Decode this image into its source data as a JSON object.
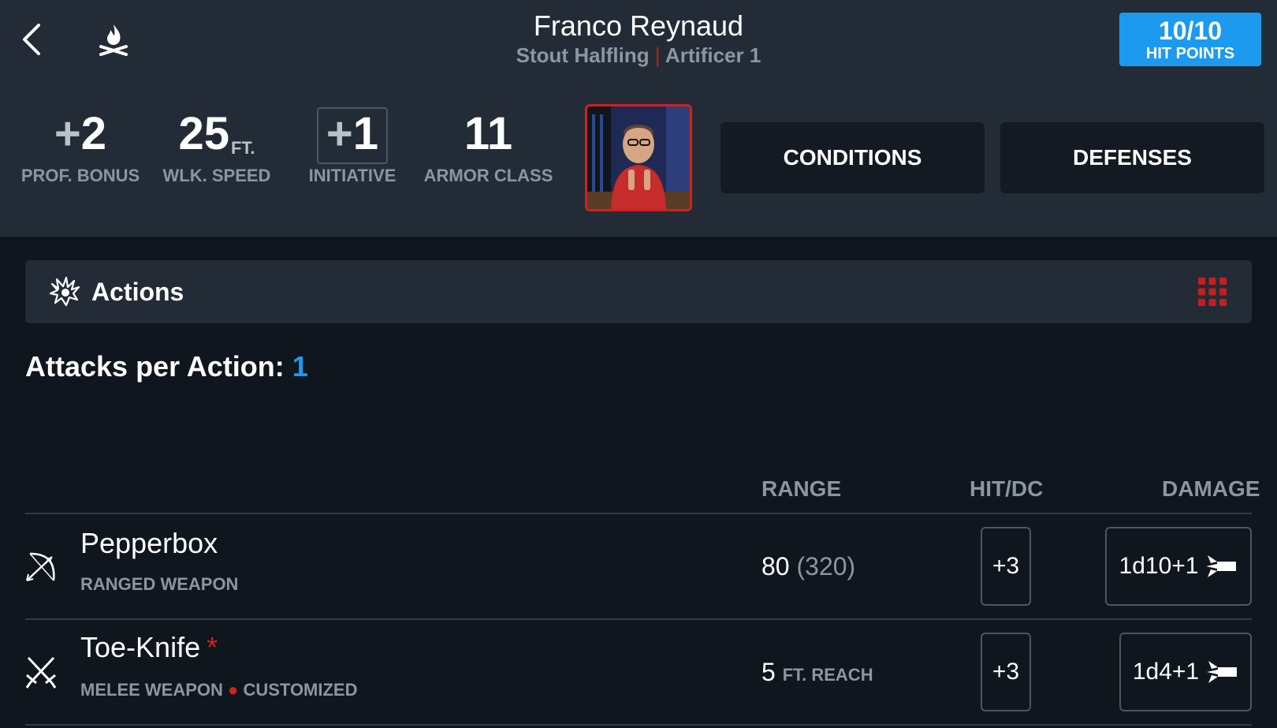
{
  "header": {
    "name": "Franco Reynaud",
    "race": "Stout Halfling",
    "separator": "|",
    "class_level": "Artificer 1",
    "hp_value": "10/10",
    "hp_label": "HIT POINTS"
  },
  "stats": {
    "prof_sign": "+",
    "prof_value": "2",
    "prof_label": "PROF. BONUS",
    "speed_value": "25",
    "speed_unit": "FT.",
    "speed_label": "WLK. SPEED",
    "init_sign": "+",
    "init_value": "1",
    "init_label": "INITIATIVE",
    "ac_value": "11",
    "ac_label": "ARMOR CLASS"
  },
  "buttons": {
    "conditions": "CONDITIONS",
    "defenses": "DEFENSES"
  },
  "actions": {
    "title": "Actions",
    "attacks_label": "Attacks per Action:",
    "attacks_value": "1"
  },
  "table": {
    "range_header": "RANGE",
    "hit_header": "HIT/DC",
    "damage_header": "DAMAGE",
    "rows": [
      {
        "name": "Pepperbox",
        "type": "RANGED WEAPON",
        "range_main": "80",
        "range_extra": "(320)",
        "hit": "+3",
        "damage": "1d10+1"
      },
      {
        "name": "Toe-Knife",
        "marker": "*",
        "type": "MELEE WEAPON",
        "type_dot": "●",
        "type_extra": "CUSTOMIZED",
        "range_main": "5",
        "range_extra": "FT. REACH",
        "hit": "+3",
        "damage": "1d4+1"
      }
    ]
  },
  "colors": {
    "accent_blue": "#1b9af0",
    "accent_red": "#d41f1f",
    "header_bg": "#232c36",
    "page_bg": "#10161d"
  },
  "icons": {
    "back": "chevron-left-icon",
    "camp": "campfire-icon",
    "actions": "action-burst-icon",
    "grid": "grid-menu-icon",
    "bow": "bow-arrow-icon",
    "swords": "crossed-swords-icon",
    "damage": "piercing-damage-icon"
  }
}
